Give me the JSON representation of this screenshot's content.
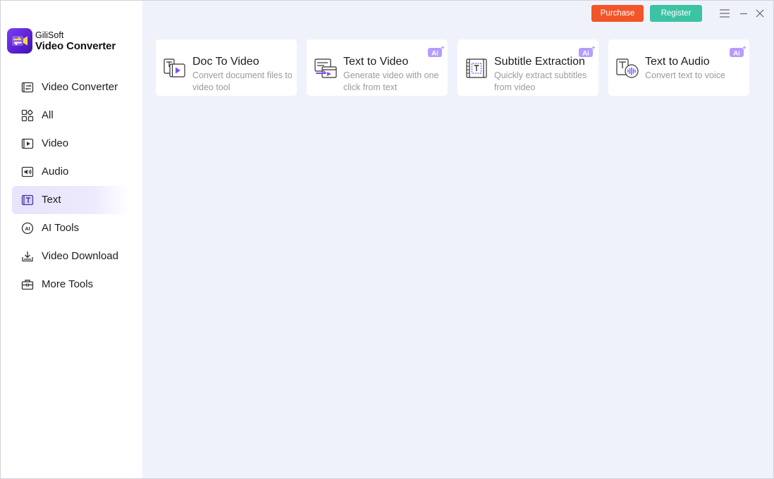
{
  "app": {
    "brand_top": "GiliSoft",
    "brand_bottom": "Video Converter",
    "logo_icon": "video-camera-convert-icon"
  },
  "titlebar": {
    "purchase_label": "Purchase",
    "register_label": "Register",
    "purchase_color": "#f25529",
    "register_color": "#3cc3a3"
  },
  "sidebar": {
    "active_index": 4,
    "items": [
      {
        "label": "Video Converter",
        "icon": "video-converter-icon"
      },
      {
        "label": "All",
        "icon": "grid-icon"
      },
      {
        "label": "Video",
        "icon": "video-play-icon"
      },
      {
        "label": "Audio",
        "icon": "audio-icon"
      },
      {
        "label": "Text",
        "icon": "text-icon"
      },
      {
        "label": "AI Tools",
        "icon": "ai-icon"
      },
      {
        "label": "Video Download",
        "icon": "download-icon"
      },
      {
        "label": "More Tools",
        "icon": "toolbox-icon"
      }
    ]
  },
  "cards": [
    {
      "title": "Doc To Video",
      "desc": "Convert document files to video tool",
      "icon": "doc-to-video-icon",
      "ai": false
    },
    {
      "title": "Text to Video",
      "desc": "Generate video with one click from text",
      "icon": "text-to-video-icon",
      "ai": true
    },
    {
      "title": "Subtitle Extraction",
      "desc": "Quickly extract subtitles from video",
      "icon": "subtitle-extraction-icon",
      "ai": true
    },
    {
      "title": "Text to Audio",
      "desc": "Convert text to voice",
      "icon": "text-to-audio-icon",
      "ai": true
    }
  ],
  "ai_badge_label": "Ai",
  "accent_color": "#7c4dff"
}
